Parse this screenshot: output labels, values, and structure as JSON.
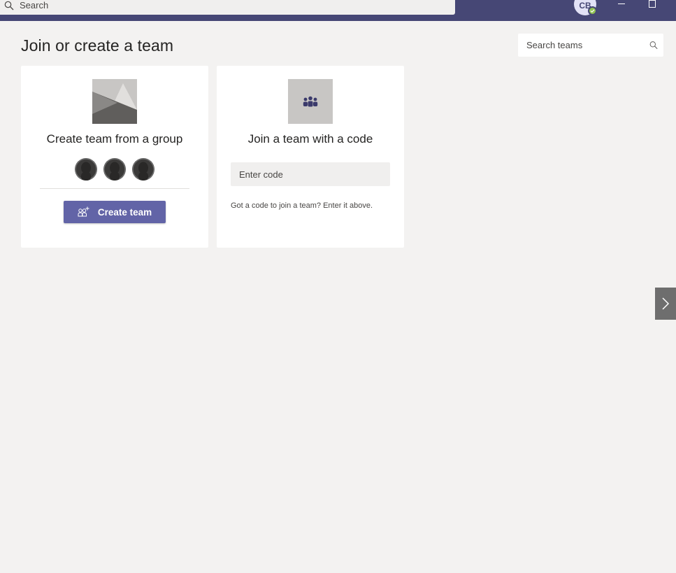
{
  "titlebar": {
    "search_placeholder": "Search",
    "avatar_initials": "CB",
    "accent_color": "#464775"
  },
  "page": {
    "title": "Join or create a team",
    "team_search_placeholder": "Search teams"
  },
  "cards": {
    "group": {
      "title": "Create team from a group",
      "button_label": "Create team"
    },
    "code": {
      "title": "Join a team with a code",
      "input_placeholder": "Enter code",
      "hint": "Got a code to join a team? Enter it above."
    }
  },
  "icons": {
    "search": "search-icon",
    "minimize": "minimize-icon",
    "maximize": "maximize-icon",
    "people": "people-icon",
    "add_people": "add-people-icon",
    "chevron": "chevron-right-icon"
  }
}
